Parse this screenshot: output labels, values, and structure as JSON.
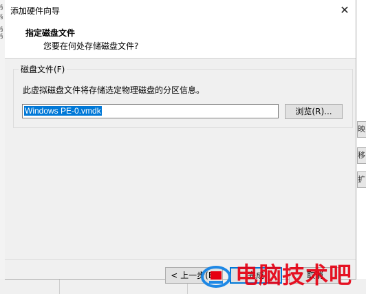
{
  "dialog": {
    "title": "添加硬件向导",
    "close_glyph": "✕",
    "header_title": "指定磁盘文件",
    "header_subtitle": "您要在何处存储磁盘文件?"
  },
  "disk_file_group": {
    "label": "磁盘文件(F)",
    "description": "此虚拟磁盘文件将存储选定物理磁盘的分区信息。",
    "path_value": "Windows PE-0.vmdk",
    "browse_label": "浏览(R)..."
  },
  "buttons": {
    "prev_label": "< 上一步(B)",
    "next_label": "完成",
    "cancel_label": "取消"
  },
  "background": {
    "left_glyphs": [
      "§",
      "§",
      "§",
      "§"
    ],
    "right_glyphs": [
      "映",
      "移",
      "扩"
    ]
  },
  "watermark": {
    "text": "电脑技术吧",
    "color": "#e60012"
  }
}
